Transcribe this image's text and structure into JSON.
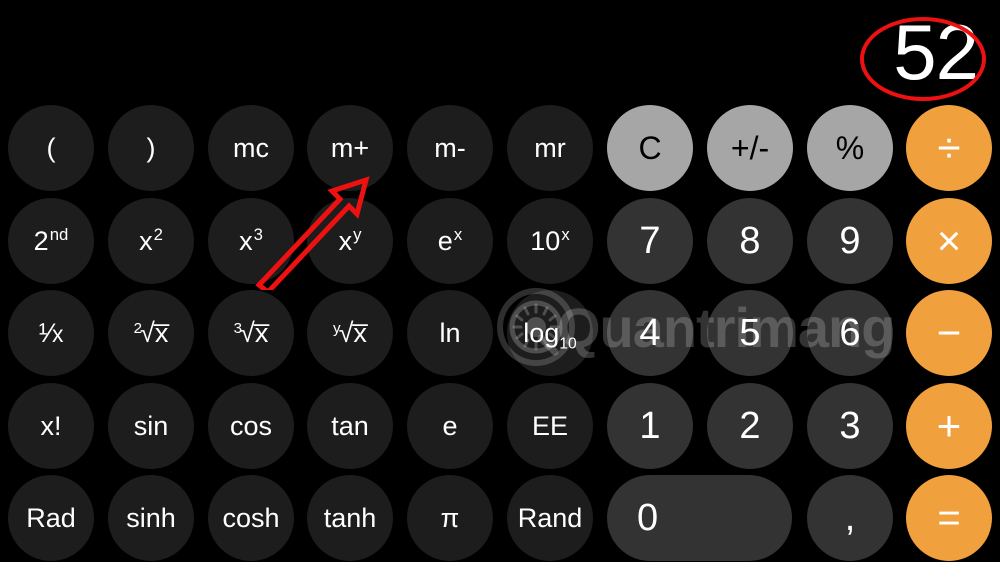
{
  "app": {
    "name": "Calculator",
    "orientation": "landscape-scientific",
    "background_color": "#000000"
  },
  "display": {
    "value": "52",
    "text_color": "#ffffff"
  },
  "annotations": [
    {
      "type": "ellipse",
      "name": "display-highlight-ellipse",
      "color": "#ee1111",
      "target": "display-value"
    },
    {
      "type": "arrow",
      "name": "memory-add-arrow",
      "color": "#ee1111",
      "target": "m+",
      "direction": "up-right"
    }
  ],
  "watermark": {
    "text": "Quantrimang",
    "logo": "circular-gear-logo",
    "color": "rgba(255,255,255,0.20)"
  },
  "colors": {
    "scientific_key": "#1d1d1d",
    "digit_key": "#333333",
    "utility_key": "#a6a6a6",
    "operator_key": "#f0a03c",
    "accent": "#f0a03c",
    "annotation": "#ee1111"
  },
  "keypad": {
    "rows": [
      {
        "keys": [
          {
            "label": "(",
            "name": "open-paren-key",
            "style": "sci",
            "col": 0
          },
          {
            "label": ")",
            "name": "close-paren-key",
            "style": "sci",
            "col": 1
          },
          {
            "label": "mc",
            "name": "memory-clear-key",
            "style": "sci",
            "col": 2
          },
          {
            "label": "m+",
            "name": "memory-add-key",
            "style": "sci",
            "col": 3
          },
          {
            "label": "m-",
            "name": "memory-subtract-key",
            "style": "sci",
            "col": 4
          },
          {
            "label": "mr",
            "name": "memory-recall-key",
            "style": "sci",
            "col": 5
          },
          {
            "label": "C",
            "name": "clear-key",
            "style": "util",
            "col": 6
          },
          {
            "label": "+/-",
            "name": "sign-toggle-key",
            "style": "util",
            "col": 7
          },
          {
            "label": "%",
            "name": "percent-key",
            "style": "util",
            "col": 8
          },
          {
            "label": "÷",
            "name": "divide-key",
            "style": "op",
            "col": 9
          }
        ]
      },
      {
        "keys": [
          {
            "label": "2nd",
            "base": "2",
            "sup": "nd",
            "name": "second-function-key",
            "style": "sci",
            "col": 0
          },
          {
            "label": "x2",
            "base": "x",
            "sup": "2",
            "name": "x-squared-key",
            "style": "sci",
            "col": 1
          },
          {
            "label": "x3",
            "base": "x",
            "sup": "3",
            "name": "x-cubed-key",
            "style": "sci",
            "col": 2
          },
          {
            "label": "xy",
            "base": "x",
            "sup": "y",
            "name": "x-power-y-key",
            "style": "sci",
            "col": 3
          },
          {
            "label": "ex",
            "base": "e",
            "sup": "x",
            "name": "e-power-x-key",
            "style": "sci",
            "col": 4
          },
          {
            "label": "10x",
            "base": "10",
            "sup": "x",
            "name": "ten-power-x-key",
            "style": "sci",
            "col": 5
          },
          {
            "label": "7",
            "name": "digit-7-key",
            "style": "digit",
            "col": 6
          },
          {
            "label": "8",
            "name": "digit-8-key",
            "style": "digit",
            "col": 7
          },
          {
            "label": "9",
            "name": "digit-9-key",
            "style": "digit",
            "col": 8
          },
          {
            "label": "×",
            "name": "multiply-key",
            "style": "op",
            "col": 9
          }
        ]
      },
      {
        "keys": [
          {
            "label": "1/x",
            "name": "reciprocal-key",
            "style": "sci",
            "col": 0,
            "glyph": "fraction"
          },
          {
            "label": "²√x",
            "index": "2",
            "name": "square-root-key",
            "style": "sci",
            "col": 1,
            "glyph": "root"
          },
          {
            "label": "³√x",
            "index": "3",
            "name": "cube-root-key",
            "style": "sci",
            "col": 2,
            "glyph": "root"
          },
          {
            "label": "ʸ√x",
            "index": "y",
            "name": "nth-root-key",
            "style": "sci",
            "col": 3,
            "glyph": "root"
          },
          {
            "label": "ln",
            "name": "natural-log-key",
            "style": "sci",
            "col": 4
          },
          {
            "label": "log10",
            "base": "log",
            "sub": "10",
            "name": "log-base-10-key",
            "style": "sci",
            "col": 5
          },
          {
            "label": "4",
            "name": "digit-4-key",
            "style": "digit",
            "col": 6
          },
          {
            "label": "5",
            "name": "digit-5-key",
            "style": "digit",
            "col": 7
          },
          {
            "label": "6",
            "name": "digit-6-key",
            "style": "digit",
            "col": 8
          },
          {
            "label": "−",
            "name": "subtract-key",
            "style": "op",
            "col": 9
          }
        ]
      },
      {
        "keys": [
          {
            "label": "x!",
            "name": "factorial-key",
            "style": "sci",
            "col": 0
          },
          {
            "label": "sin",
            "name": "sine-key",
            "style": "sci",
            "col": 1
          },
          {
            "label": "cos",
            "name": "cosine-key",
            "style": "sci",
            "col": 2
          },
          {
            "label": "tan",
            "name": "tangent-key",
            "style": "sci",
            "col": 3
          },
          {
            "label": "e",
            "name": "euler-key",
            "style": "sci",
            "col": 4
          },
          {
            "label": "EE",
            "name": "exponent-key",
            "style": "sci",
            "col": 5
          },
          {
            "label": "1",
            "name": "digit-1-key",
            "style": "digit",
            "col": 6
          },
          {
            "label": "2",
            "name": "digit-2-key",
            "style": "digit",
            "col": 7
          },
          {
            "label": "3",
            "name": "digit-3-key",
            "style": "digit",
            "col": 8
          },
          {
            "label": "+",
            "name": "add-key",
            "style": "op",
            "col": 9
          }
        ]
      },
      {
        "keys": [
          {
            "label": "Rad",
            "name": "radians-key",
            "style": "sci",
            "col": 0
          },
          {
            "label": "sinh",
            "name": "hyperbolic-sine-key",
            "style": "sci",
            "col": 1
          },
          {
            "label": "cosh",
            "name": "hyperbolic-cosine-key",
            "style": "sci",
            "col": 2
          },
          {
            "label": "tanh",
            "name": "hyperbolic-tangent-key",
            "style": "sci",
            "col": 3
          },
          {
            "label": "π",
            "name": "pi-key",
            "style": "sci",
            "col": 4
          },
          {
            "label": "Rand",
            "name": "random-key",
            "style": "sci",
            "col": 5
          },
          {
            "label": "0",
            "name": "digit-0-key",
            "style": "digit zero",
            "col": 6
          },
          {
            "label": ",",
            "name": "decimal-separator-key",
            "style": "digit",
            "col": 8
          },
          {
            "label": "=",
            "name": "equals-key",
            "style": "op",
            "col": 9
          }
        ]
      }
    ]
  }
}
